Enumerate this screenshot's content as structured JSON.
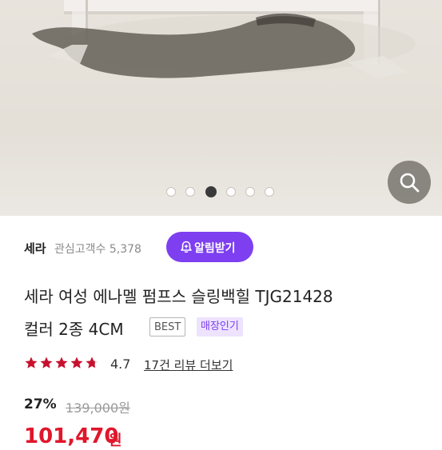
{
  "gallery": {
    "image_description_icon": "shoe-photo",
    "page_count": 6,
    "active_page": 3,
    "zoom_icon": "magnifier-icon"
  },
  "brand": {
    "name": "세라",
    "favorite_label": "관심고객수 5,378",
    "alarm_button_label": "알림받기",
    "alarm_icon": "bell-plus-icon",
    "accent_color": "#7d3ff0"
  },
  "product": {
    "title_line1": "세라 여성 에나멜 펌프스 슬링백힐 TJG21428",
    "title_line2": "컬러 2종 4CM",
    "badge_best": "BEST",
    "badge_store": "매장인기"
  },
  "rating": {
    "value": "4.7",
    "stars": 4.7,
    "star_color": "#c8102e",
    "review_link": "17건 리뷰 더보기"
  },
  "price": {
    "discount": "27%",
    "original": "139,000원",
    "sale": "101,470",
    "sale_unit": "원",
    "sale_color": "#e0162b"
  }
}
